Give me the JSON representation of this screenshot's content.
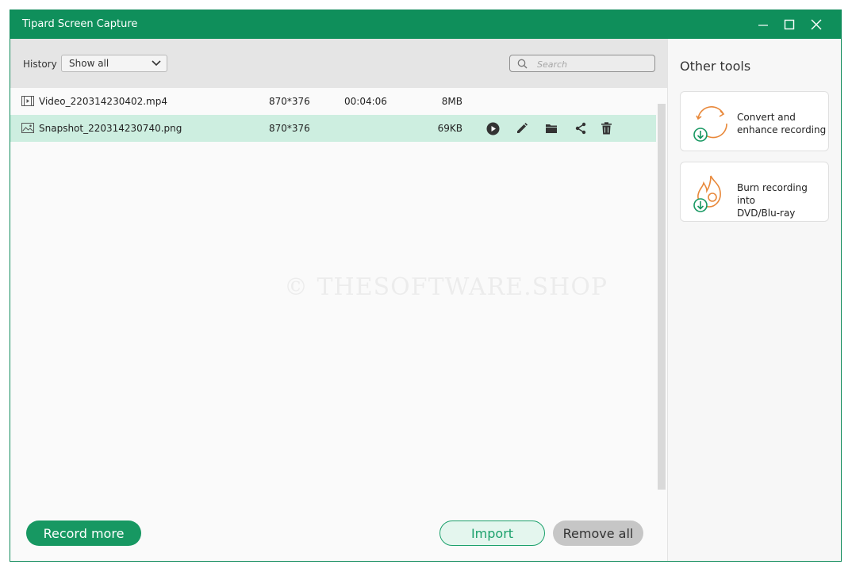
{
  "window": {
    "title": "Tipard Screen Capture"
  },
  "toolbar": {
    "history_label": "History",
    "filter_value": "Show all",
    "search_placeholder": "Search"
  },
  "files": [
    {
      "icon": "video-file-icon",
      "name": "Video_220314230402.mp4",
      "resolution": "870*376",
      "duration": "00:04:06",
      "size": "8MB",
      "selected": false
    },
    {
      "icon": "image-file-icon",
      "name": "Snapshot_220314230740.png",
      "resolution": "870*376",
      "duration": "",
      "size": "69KB",
      "selected": true
    }
  ],
  "row_actions": [
    "play-icon",
    "edit-icon",
    "folder-icon",
    "share-icon",
    "delete-icon"
  ],
  "watermark": "© THESOFTWARE.SHOP",
  "buttons": {
    "record_more": "Record more",
    "import": "Import",
    "remove_all": "Remove all"
  },
  "other_tools": {
    "title": "Other tools",
    "cards": [
      {
        "icon": "convert-icon",
        "line1": "Convert and",
        "line2": "enhance recording"
      },
      {
        "icon": "burn-disc-icon",
        "line1": "Burn recording into",
        "line2": "DVD/Blu-ray"
      }
    ]
  },
  "colors": {
    "brand": "#0f8f5b",
    "selected_row": "#cdeee0",
    "accent_orange": "#e8883a"
  }
}
